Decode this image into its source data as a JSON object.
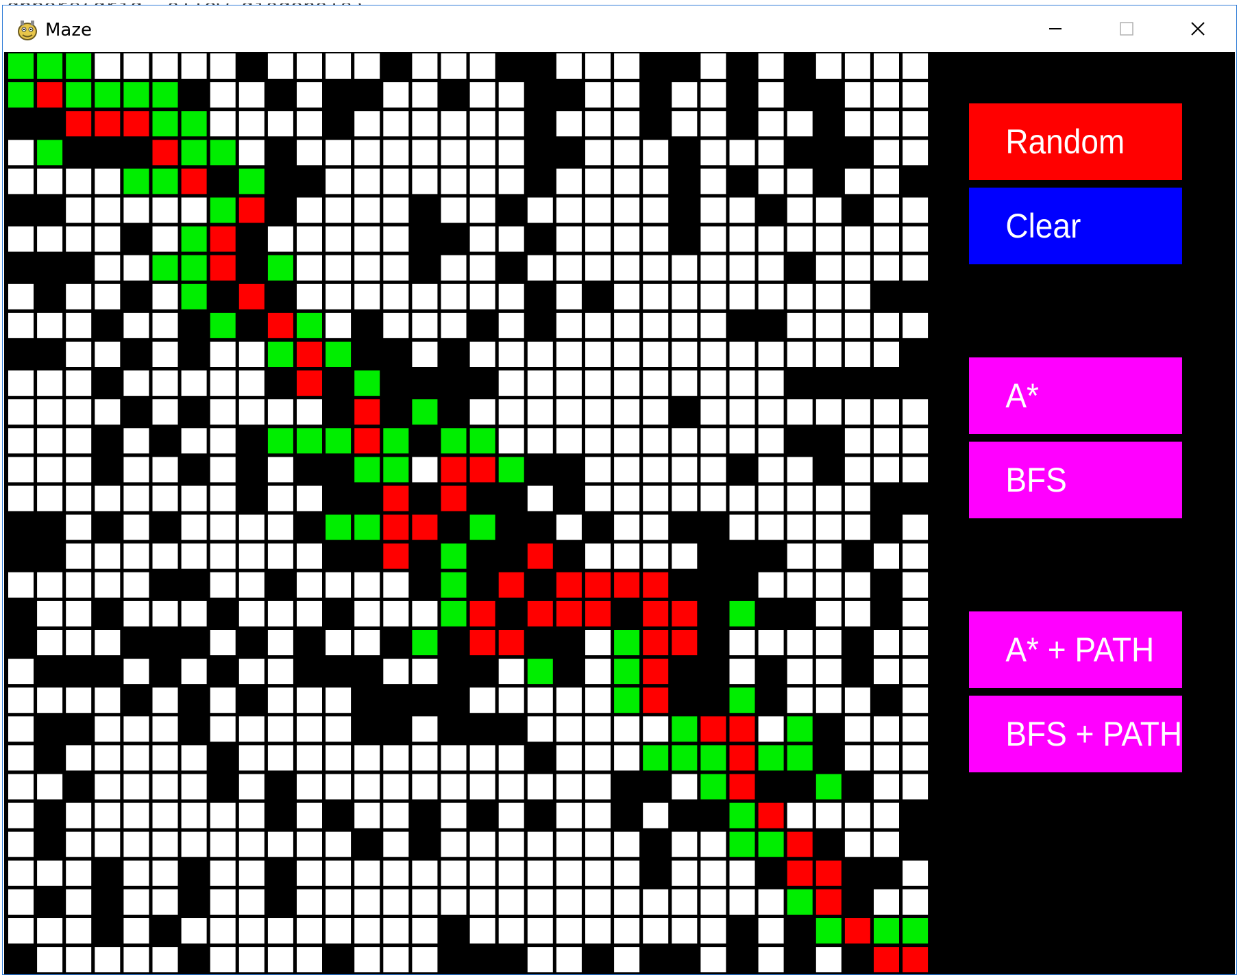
{
  "window": {
    "title": "Maze",
    "background_fragment": "gnbors(grid, allow_diagonals)"
  },
  "colors": {
    "wall": "#000000",
    "open": "#ffffff",
    "visited": "#00ee00",
    "path": "#ff0000",
    "btn_random": "#ff0000",
    "btn_clear": "#0000ff",
    "btn_algo": "#ff00ff"
  },
  "buttons": {
    "random": "Random",
    "clear": "Clear",
    "astar": "A*",
    "bfs": "BFS",
    "astar_path": "A* + PATH",
    "bfs_path": "BFS + PATH"
  },
  "maze": {
    "cols": 32,
    "rows": 32,
    "legend": "# = wall, . = open, g = visited (green), r = path (red)",
    "grid": [
      "ggg.....#....#...##...##.#.#....",
      "grgggg#..#.##..#..##..#..#.##...",
      "##rrrgg....#......#...#..#..#...",
      ".g###rgg.#........##...#...###..",
      "....ggr#g##.......#....#.#..#..#",
      "##.....gr#....#..#.....#..#..#..",
      "....#.gr#.....##..#....#........",
      "###..ggr#g....#..#.........#....",
      ".#..#.g#r#........#.#.........##",
      "...#..#g#rg.#...#.#......##.....",
      "##..#.#..grg##.#...............#",
      "...#.....#r#g####..........#####",
      "....#.#....#r#g#.......#........",
      "...#.#..#gggrg#gg..........##...",
      "...#..#.#.##gg.rrg##.....#..#...",
      "........#..##r#r##.#..........##",
      "##.#.#....#ggrr#g##.#..##.....#.",
      "##.........##r#g##r#....###..#..",
      ".....##..#....#g#r#rrrr###....#.",
      "#..#...#...#...gr#rrr#rr#g##..#.",
      "#...###.#.#..#g#rr##.grr#....#..",
      ".###.#.#..###..##.g#.gr##.#..#..",
      "....#.#.#...####.....gr##g#...#.",
      ".##...#.....##.###.....grr.g#...",
      ".#.....#..........#...gggrgg#...",
      "..#....#.#...........##.gr##g#..",
      ".#.......#.#..#.#.#..#.##gr....#",
      ".#..........#.#.......#..ggr#..#",
      "...#..#..#............#...#rr##.",
      ".#.#..#..#.................gr#..",
      "...#.#.........#.........#.#grgg",
      "#.....#....#...###..#.##.#.#.#rr"
    ]
  }
}
